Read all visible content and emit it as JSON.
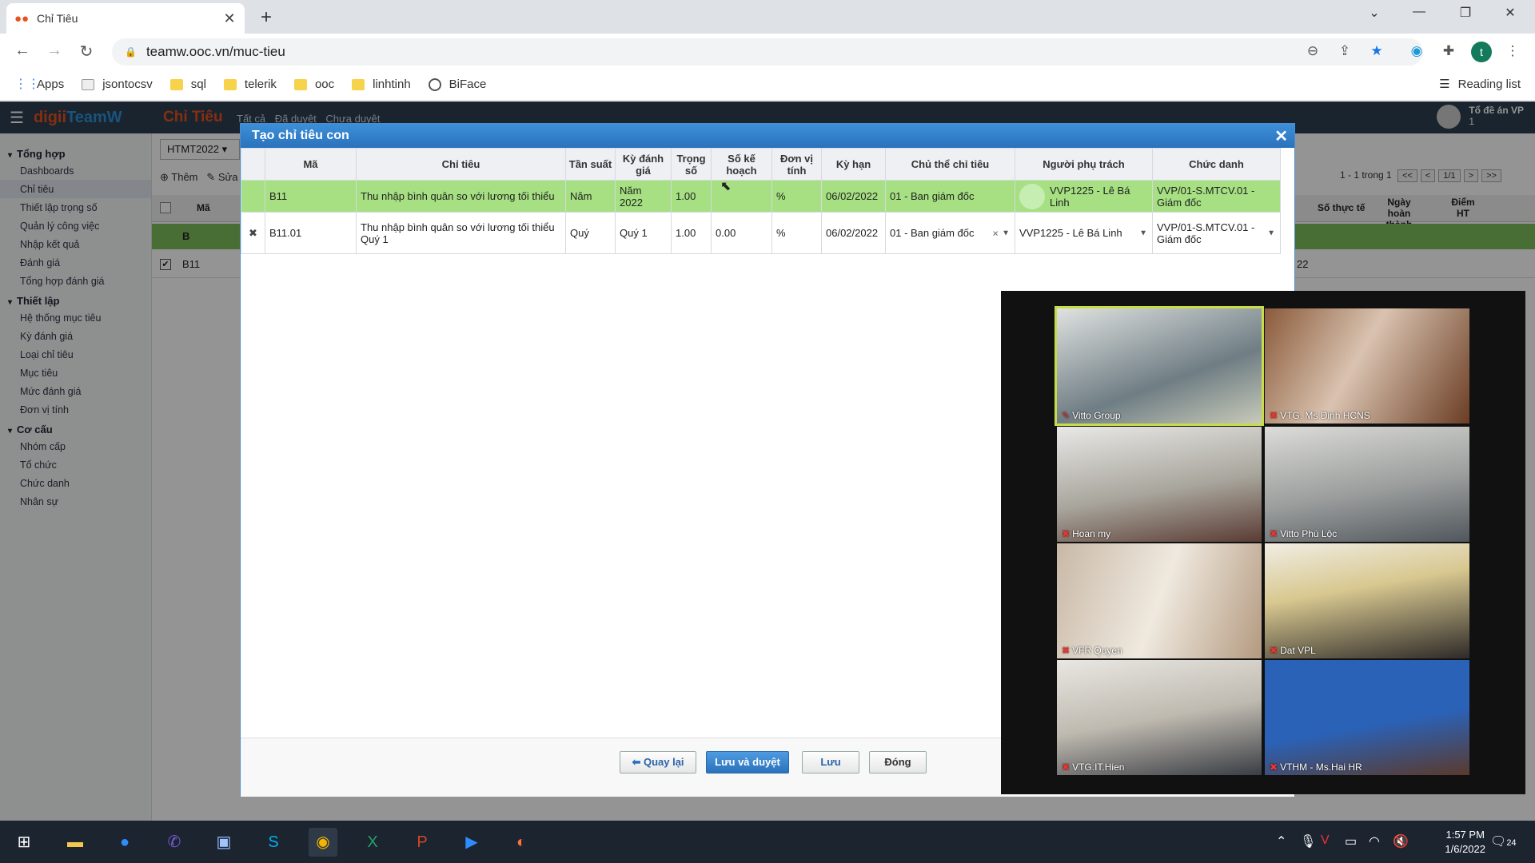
{
  "browser": {
    "tab_title": "Chỉ Tiêu",
    "url": "teamw.ooc.vn/muc-tieu",
    "bookmarks": [
      "Apps",
      "jsontocsv",
      "sql",
      "telerik",
      "ooc",
      "linhtinh",
      "BiFace"
    ],
    "reading_list": "Reading list",
    "profile_initial": "t"
  },
  "app": {
    "logo_a": "digii",
    "logo_b": "TeamW",
    "page_title": "Chỉ Tiêu",
    "top_tabs": [
      "Tất cả",
      "Đã duyệt",
      "Chưa duyệt"
    ],
    "user_name": "Tổ đề án VP",
    "user_sub": "1",
    "filter_value": "HTMT2022",
    "actions": [
      "Thêm",
      "Sửa"
    ],
    "paging": "1 - 1 trong 1",
    "paging_page": "1/1",
    "bg_headers": [
      "Mã",
      "Số thực tế",
      "Ngày hoàn thành",
      "Điểm HT"
    ],
    "bg_row1_code": "B",
    "bg_row2_code": "B11",
    "bg_row2_val": "22"
  },
  "sidebar": {
    "sections": [
      {
        "title": "Tổng hợp",
        "items": [
          "Dashboards",
          "Chỉ tiêu",
          "Thiết lập trọng số",
          "Quản lý công việc",
          "Nhập kết quả",
          "Đánh giá",
          "Tổng hợp đánh giá"
        ]
      },
      {
        "title": "Thiết lập",
        "items": [
          "Hệ thống mục tiêu",
          "Kỳ đánh giá",
          "Loại chỉ tiêu",
          "Mục tiêu",
          "Mức đánh giá",
          "Đơn vị tính"
        ]
      },
      {
        "title": "Cơ cấu",
        "items": [
          "Nhóm cấp",
          "Tổ chức",
          "Chức danh",
          "Nhân sự"
        ]
      }
    ]
  },
  "modal": {
    "title": "Tạo chỉ tiêu con",
    "headers": [
      "Mã",
      "Chỉ tiêu",
      "Tần suất",
      "Kỳ đánh giá",
      "Trọng số",
      "Số kế hoạch",
      "Đơn vị tính",
      "Kỳ hạn",
      "Chủ thể chỉ tiêu",
      "Người phụ trách",
      "Chức danh"
    ],
    "parent_row": {
      "code": "B11",
      "name": "Thu nhập bình quân so với lương tối thiểu",
      "freq": "Năm",
      "period": "Năm 2022",
      "weight": "1.00",
      "plan": "",
      "unit": "%",
      "due": "06/02/2022",
      "owner": "01 - Ban giám đốc",
      "person": "VVP1225 - Lê Bá Linh",
      "title": "VVP/01-S.MTCV.01 - Giám đốc"
    },
    "child_row": {
      "code": "B11.01",
      "name": "Thu nhập bình quân so với lương tối thiểu Quý 1",
      "freq": "Quý",
      "period": "Quý 1",
      "weight": "1.00",
      "plan": "0.00",
      "unit": "%",
      "due": "06/02/2022",
      "owner": "01 - Ban giám đốc",
      "person": "VVP1225 - Lê Bá Linh",
      "title": "VVP/01-S.MTCV.01 - Giám đốc"
    },
    "buttons": {
      "back": "Quay lại",
      "save_approve": "Lưu và duyệt",
      "save": "Lưu",
      "close": "Đóng"
    }
  },
  "zoom": {
    "participants": [
      "Vitto Group",
      "VTG. Ms Dinh HCNS",
      "Hoan my",
      "Vitto Phú Lộc",
      "VFR Quyen",
      "Dat VPL",
      "VTG.IT.Hien",
      "VTHM - Ms.Hai HR"
    ]
  },
  "taskbar": {
    "time": "1:57 PM",
    "date": "1/6/2022",
    "notifications": "24"
  }
}
